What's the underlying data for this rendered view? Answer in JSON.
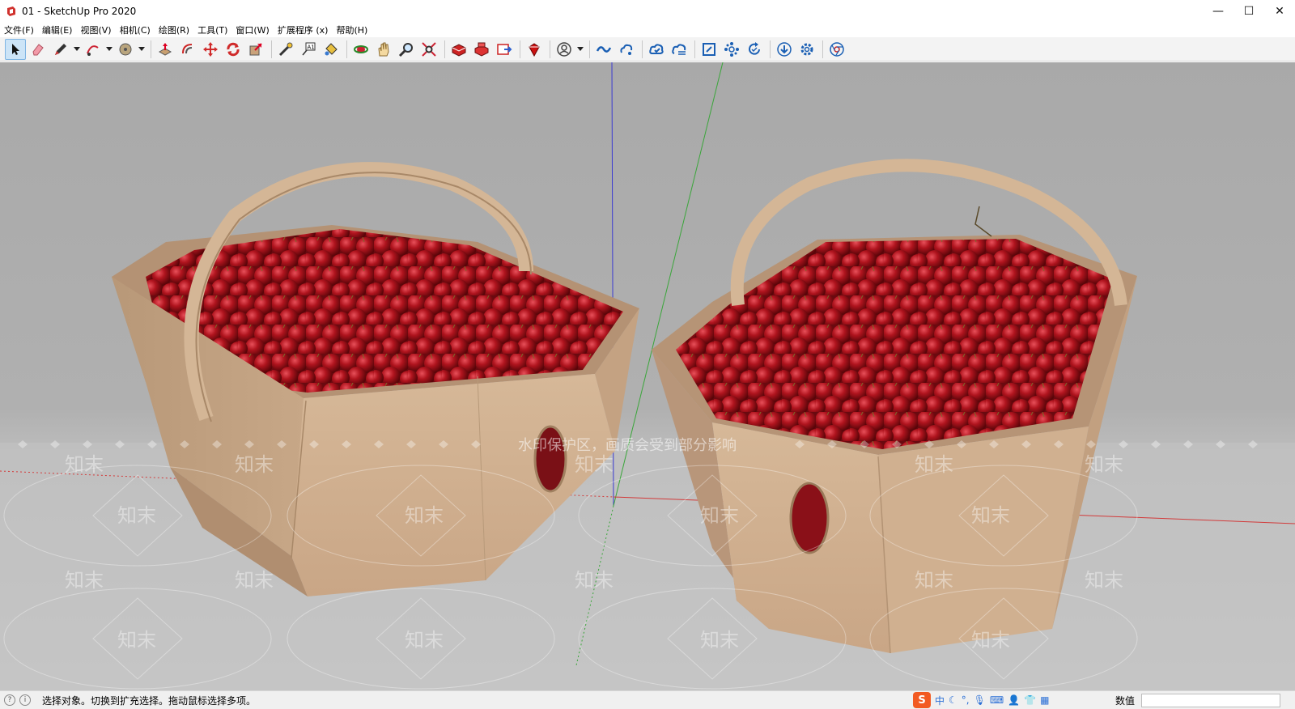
{
  "window": {
    "title": "01 - SketchUp Pro 2020",
    "minimize": "—",
    "maximize": "☐",
    "close": "✕"
  },
  "menu": [
    {
      "label": "文件(F)"
    },
    {
      "label": "编辑(E)"
    },
    {
      "label": "视图(V)"
    },
    {
      "label": "相机(C)"
    },
    {
      "label": "绘图(R)"
    },
    {
      "label": "工具(T)"
    },
    {
      "label": "窗口(W)"
    },
    {
      "label": "扩展程序 (x)"
    },
    {
      "label": "帮助(H)"
    }
  ],
  "toolbar": {
    "tools": [
      "select-tool-icon",
      "eraser-tool-icon",
      "pencil-tool-icon",
      "arc-tool-icon",
      "shapes-tool-icon",
      "push-pull-tool-icon",
      "offset-tool-icon",
      "move-tool-icon",
      "rotate-tool-icon",
      "scale-tool-icon",
      "tape-measure-tool-icon",
      "text-tool-icon",
      "paint-bucket-tool-icon",
      "orbit-tool-icon",
      "pan-tool-icon",
      "zoom-tool-icon",
      "zoom-extents-icon",
      "warehouse-icon",
      "extension-warehouse-icon",
      "layout-send-icon",
      "extension-manager-icon",
      "account-icon",
      "trimble-connect-icon",
      "trimble-collab-icon",
      "cloud-upload-icon",
      "cloud-sync-icon",
      "frame-icon",
      "scene-network-icon",
      "refresh-icon",
      "download-icon",
      "settings-icon",
      "chrome-icon"
    ]
  },
  "viewport": {
    "watermark_banner": "水印保护区，画质会受到部分影响",
    "watermark_logo": "知末",
    "axis_colors": {
      "red": "#d23a3a",
      "green": "#3aa63a",
      "blue": "#3a3ad2"
    }
  },
  "status": {
    "message": "选择对象。切换到扩充选择。拖动鼠标选择多项。",
    "measurements_label": "数值",
    "measurements_value": "",
    "ime_mode": "中"
  }
}
